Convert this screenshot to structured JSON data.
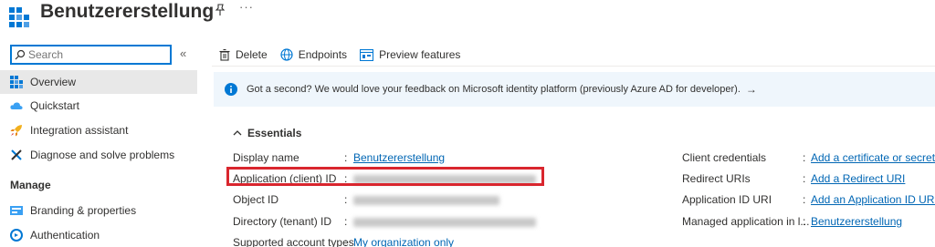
{
  "header": {
    "title": "Benutzererstellung"
  },
  "sidebar": {
    "search_placeholder": "Search",
    "collapse_glyph": "«",
    "items": [
      {
        "label": "Overview",
        "icon": "grid-icon",
        "active": true
      },
      {
        "label": "Quickstart",
        "icon": "cloud-icon"
      },
      {
        "label": "Integration assistant",
        "icon": "rocket-icon"
      },
      {
        "label": "Diagnose and solve problems",
        "icon": "wrench-icon"
      }
    ],
    "section_manage": "Manage",
    "manage_items": [
      {
        "label": "Branding & properties",
        "icon": "branding-icon"
      },
      {
        "label": "Authentication",
        "icon": "authentication-icon"
      }
    ]
  },
  "toolbar": {
    "delete_label": "Delete",
    "endpoints_label": "Endpoints",
    "preview_label": "Preview features"
  },
  "banner": {
    "text": "Got a second? We would love your feedback on Microsoft identity platform (previously Azure AD for developer).",
    "arrow": "→"
  },
  "essentials": {
    "title": "Essentials",
    "left": [
      {
        "label": "Display name",
        "value": "Benutzererstellung",
        "link": true
      },
      {
        "label": "Application (client) ID",
        "value": "",
        "redacted": true
      },
      {
        "label": "Object ID",
        "value": "",
        "redacted": true
      },
      {
        "label": "Directory (tenant) ID",
        "value": "",
        "redacted": true
      },
      {
        "label": "Supported account types",
        "value": "My organization only",
        "link": true
      }
    ],
    "right": [
      {
        "label": "Client credentials",
        "value": "Add a certificate or secret"
      },
      {
        "label": "Redirect URIs",
        "value": "Add a Redirect URI"
      },
      {
        "label": "Application ID URI",
        "value": "Add an Application ID URI"
      },
      {
        "label": "Managed application in l...",
        "value": "Benutzererstellung"
      }
    ]
  },
  "colors": {
    "accent": "#0078d4",
    "link": "#0066b4",
    "highlight": "#d9262e",
    "banner_bg": "#eff6fc"
  }
}
